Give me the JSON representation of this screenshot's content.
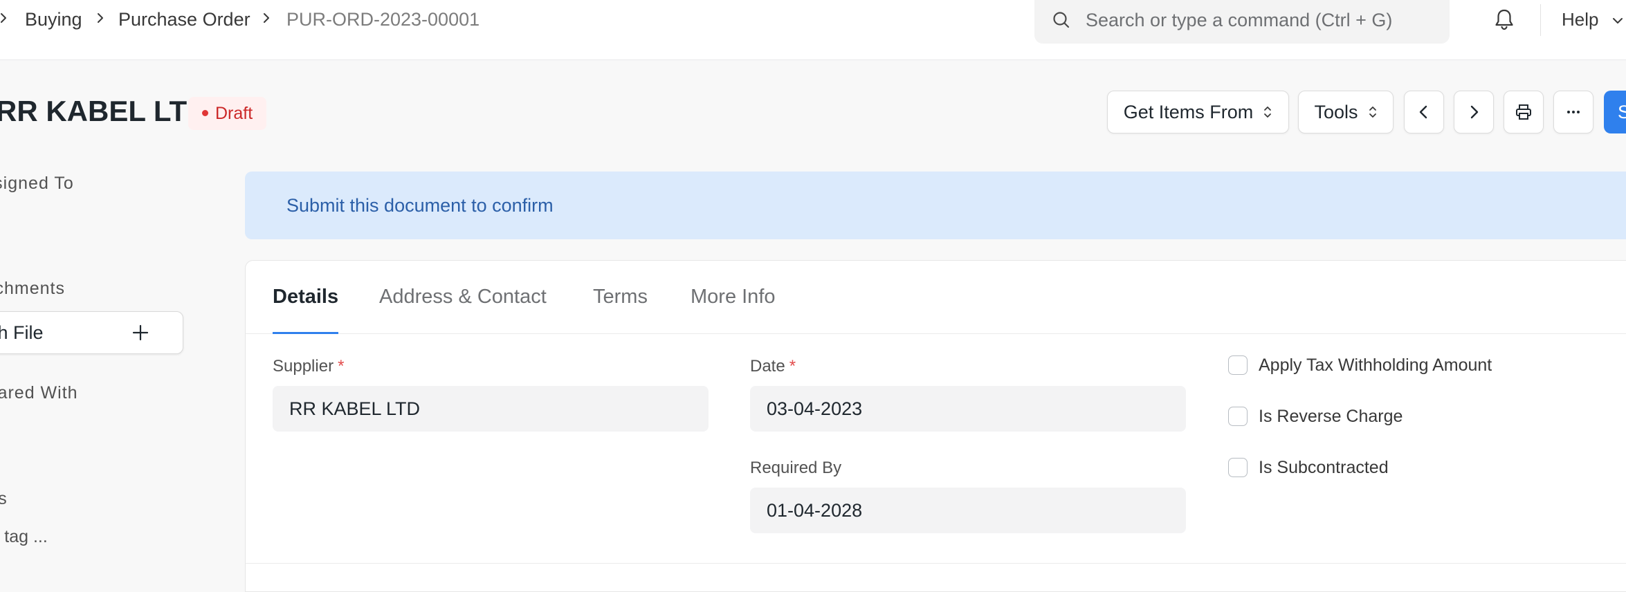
{
  "navbar": {
    "breadcrumbs": [
      "Buying",
      "Purchase Order",
      "PUR-ORD-2023-00001"
    ],
    "search_placeholder": "Search or type a command (Ctrl + G)",
    "help_label": "Help"
  },
  "page_head": {
    "title": "RR KABEL LTD",
    "status": "Draft",
    "status_color": "#cc2929",
    "buttons": {
      "get_items_from": "Get Items From",
      "tools": "Tools",
      "submit": "Submit"
    },
    "icons": [
      "chevron-left-icon",
      "chevron-right-icon",
      "printer-icon",
      "more-icon"
    ]
  },
  "sidebar": {
    "assigned_to": "Assigned To",
    "attachments": "Attachments",
    "attach_file": "Attach File",
    "shared_with": "Shared With",
    "tags": "Tags",
    "add_tag": "Add a tag ..."
  },
  "alert": {
    "message": "Submit this document to confirm"
  },
  "form": {
    "tabs": [
      {
        "label": "Details",
        "active": true
      },
      {
        "label": "Address & Contact",
        "active": false
      },
      {
        "label": "Terms",
        "active": false
      },
      {
        "label": "More Info",
        "active": false
      }
    ],
    "supplier": {
      "label": "Supplier",
      "value": "RR KABEL LTD",
      "required": "*"
    },
    "date": {
      "label": "Date",
      "value": "03-04-2023",
      "required": "*"
    },
    "required_by": {
      "label": "Required By",
      "value": "01-04-2028"
    },
    "checkboxes": [
      {
        "label": "Apply Tax Withholding Amount",
        "checked": false
      },
      {
        "label": "Is Reverse Charge",
        "checked": false
      },
      {
        "label": "Is Subcontracted",
        "checked": false
      }
    ]
  },
  "colors": {
    "primary": "#2f80ed",
    "alert_bg": "#dbeafc",
    "alert_text": "#2b5fa8"
  }
}
